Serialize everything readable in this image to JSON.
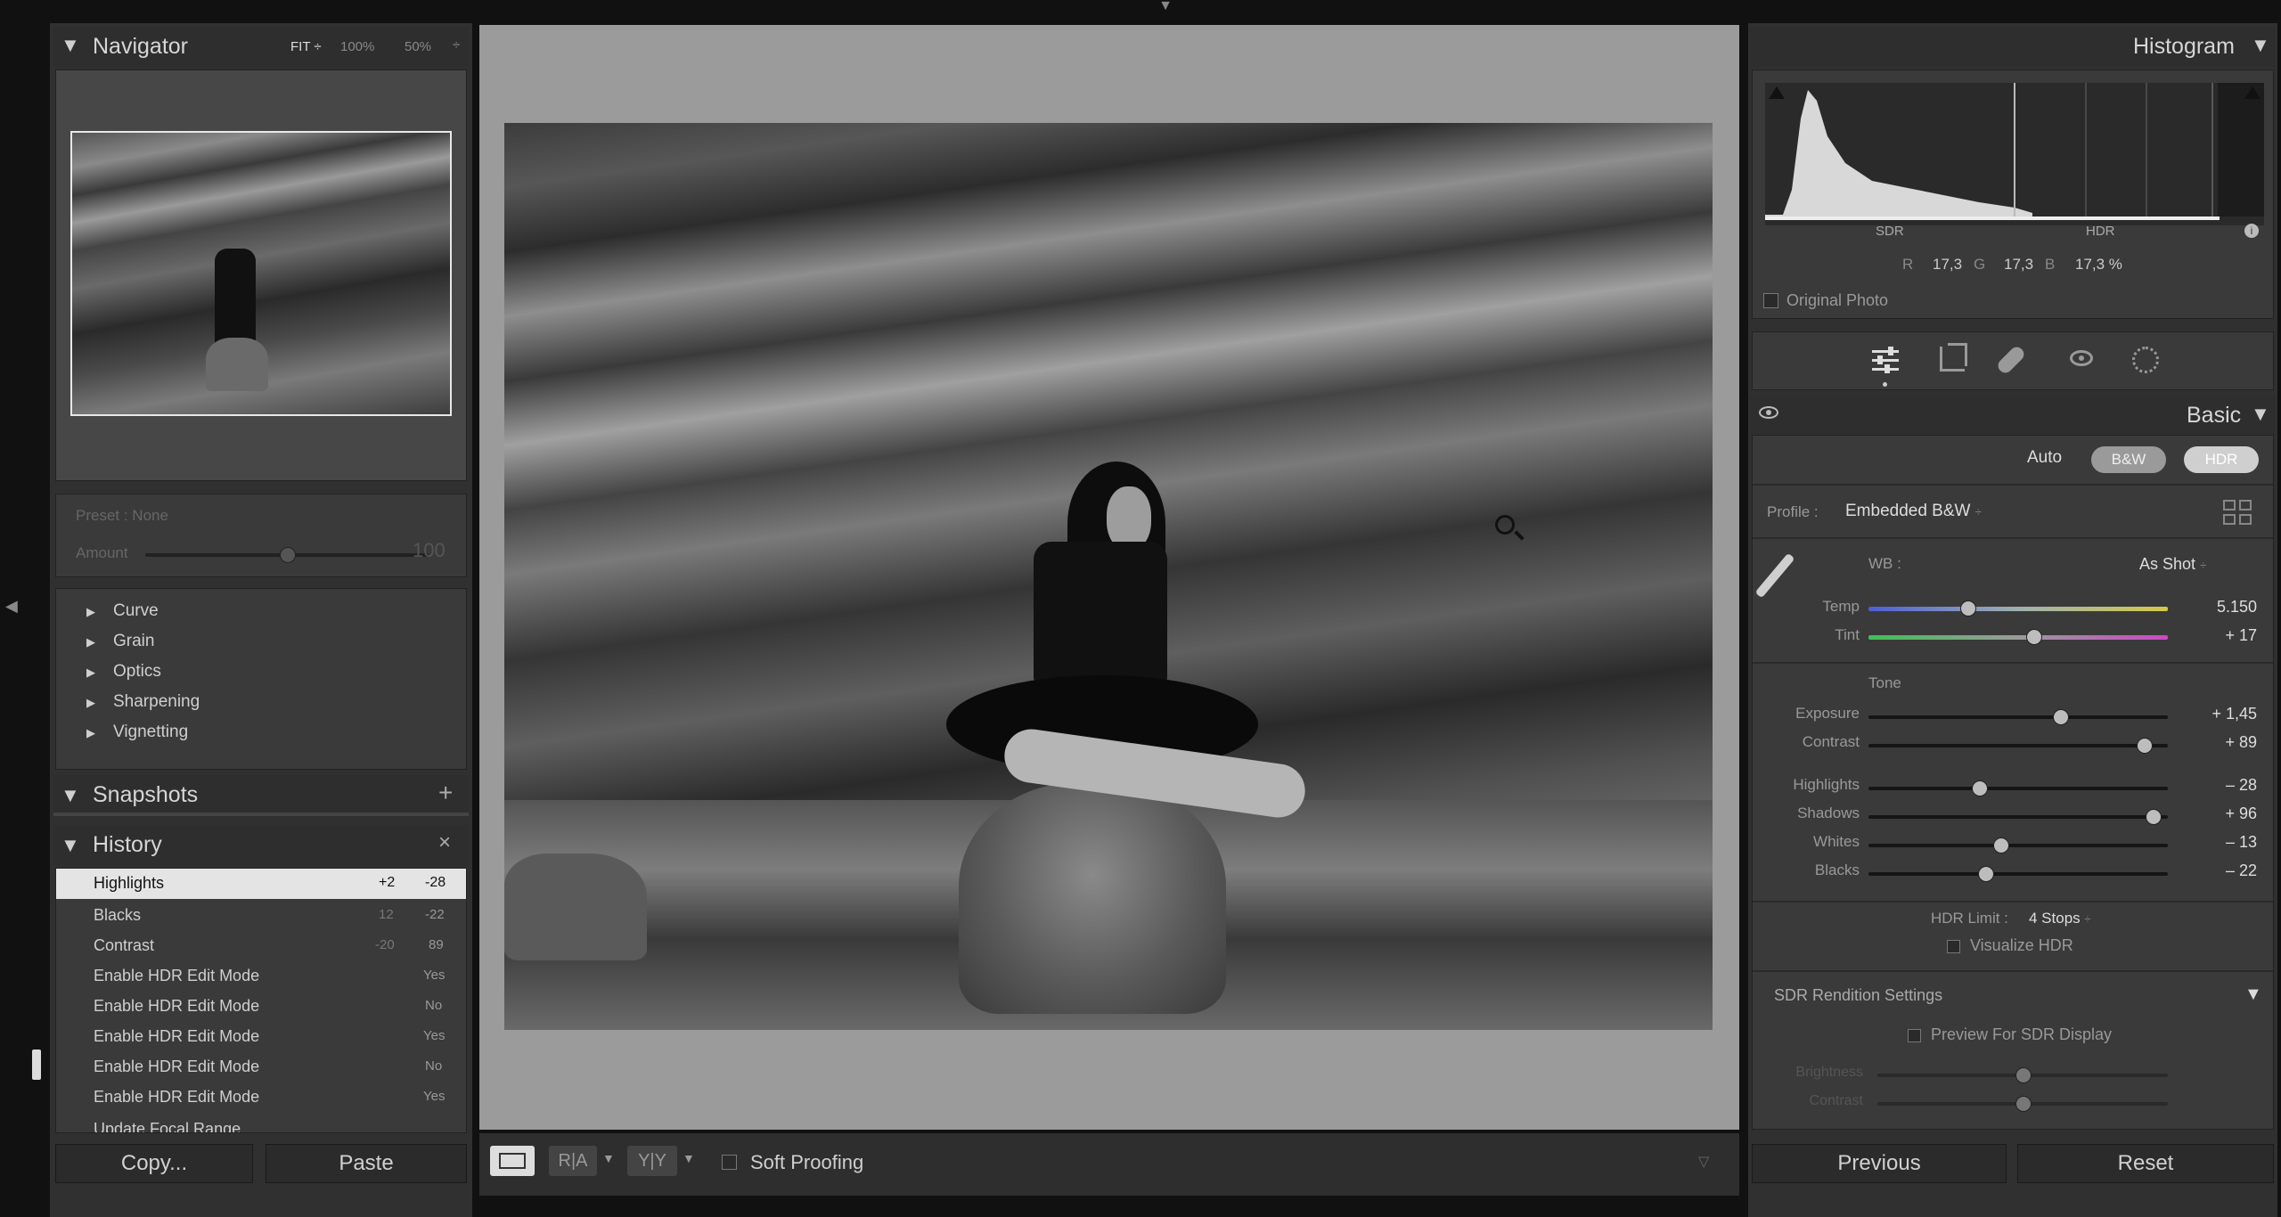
{
  "navigator": {
    "title": "Navigator",
    "zoom_options": [
      "FIT",
      "100%",
      "50%"
    ]
  },
  "preset": {
    "label": "Preset : None",
    "amount_label": "Amount",
    "amount_value": "100",
    "amount_level": 0.5
  },
  "collapsed_sections": [
    "Curve",
    "Grain",
    "Optics",
    "Sharpening",
    "Vignetting"
  ],
  "snapshots": {
    "title": "Snapshots",
    "add": "+"
  },
  "history": {
    "title": "History",
    "close": "×",
    "items": [
      {
        "name": "Highlights",
        "a": "+2",
        "b": "-28"
      },
      {
        "name": "Blacks",
        "a": "12",
        "b": "-22"
      },
      {
        "name": "Contrast",
        "a": "-20",
        "b": "89"
      },
      {
        "name": "Enable HDR Edit Mode",
        "a": "",
        "b": "Yes"
      },
      {
        "name": "Enable HDR Edit Mode",
        "a": "",
        "b": "No"
      },
      {
        "name": "Enable HDR Edit Mode",
        "a": "",
        "b": "Yes"
      },
      {
        "name": "Enable HDR Edit Mode",
        "a": "",
        "b": "No"
      },
      {
        "name": "Enable HDR Edit Mode",
        "a": "",
        "b": "Yes"
      },
      {
        "name": "Update Focal Range",
        "a": "",
        "b": ""
      }
    ]
  },
  "left_buttons": {
    "copy": "Copy...",
    "paste": "Paste"
  },
  "toolbar": {
    "soft_proofing": "Soft Proofing",
    "view_ra": "R|A",
    "view_yy": "Y|Y"
  },
  "histogram": {
    "title": "Histogram",
    "sdr": "SDR",
    "hdr": "HDR",
    "r_label": "R",
    "r_value": "17,3",
    "g_label": "G",
    "g_value": "17,3",
    "b_label": "B",
    "b_value": "17,3 %",
    "original_photo": "Original Photo"
  },
  "basic": {
    "title": "Basic",
    "auto": "Auto",
    "bw": "B&W",
    "hdr": "HDR",
    "profile_label": "Profile :",
    "profile_value": "Embedded B&W",
    "wb_label": "WB :",
    "wb_value": "As Shot",
    "tone_label": "Tone",
    "hdr_limit_label": "HDR Limit :",
    "hdr_limit_value": "4 Stops",
    "visualize_hdr": "Visualize HDR",
    "sdr_rendition": "SDR Rendition Settings",
    "preview_sdr": "Preview For SDR Display",
    "brightness": "Brightness",
    "contrast2": "Contrast",
    "sliders": [
      {
        "name": "Temp",
        "value": "5.150",
        "level": 0.33
      },
      {
        "name": "Tint",
        "value": "+ 17",
        "level": 0.55
      },
      {
        "name": "Exposure",
        "value": "+ 1,45",
        "level": 0.64
      },
      {
        "name": "Contrast",
        "value": "+ 89",
        "level": 0.92
      },
      {
        "name": "Highlights",
        "value": "– 28",
        "level": 0.37
      },
      {
        "name": "Shadows",
        "value": "+ 96",
        "level": 0.95
      },
      {
        "name": "Whites",
        "value": "– 13",
        "level": 0.44
      },
      {
        "name": "Blacks",
        "value": "– 22",
        "level": 0.39
      }
    ]
  },
  "right_buttons": {
    "previous": "Previous",
    "reset": "Reset"
  }
}
